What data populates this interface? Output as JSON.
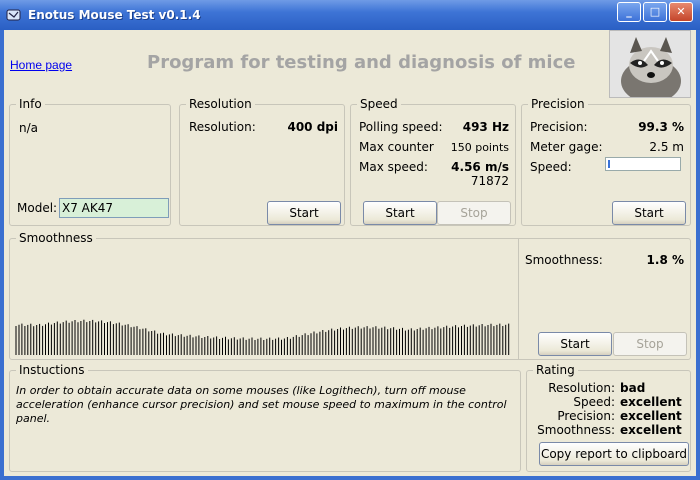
{
  "window": {
    "title": "Enotus Mouse Test v0.1.4",
    "minimize": "_",
    "maximize": "□",
    "close": "✕"
  },
  "header": {
    "home_link": "Home page",
    "headline": "Program for testing and diagnosis of mice"
  },
  "info": {
    "legend": "Info",
    "value": "n/a",
    "model_label": "Model:",
    "model_value": "X7 AK47"
  },
  "resolution": {
    "legend": "Resolution",
    "label": "Resolution:",
    "value": "400 dpi",
    "start": "Start"
  },
  "speed": {
    "legend": "Speed",
    "polling_label": "Polling speed:",
    "polling_value": "493 Hz",
    "max_counter_label": "Max counter",
    "max_counter_value": "150 points",
    "max_speed_label": "Max  speed:",
    "max_speed_value": "4.56 m/s",
    "extra_value": "71872",
    "start": "Start",
    "stop": "Stop"
  },
  "precision": {
    "legend": "Precision",
    "precision_label": "Precision:",
    "precision_value": "99.3 %",
    "gage_label": "Meter gage:",
    "gage_value": "2.5 m",
    "speed_label": "Speed:",
    "speed_fraction": 0.03,
    "start": "Start"
  },
  "smoothness": {
    "legend": "Smoothness",
    "label": "Smoothness:",
    "value": "1.8 %",
    "start": "Start",
    "stop": "Stop",
    "accent": "#000000"
  },
  "instructions": {
    "legend": "Instuctions",
    "text": "In order to obtain accurate data on some mouses (like Logithech), turn off mouse acceleration (enhance cursor precision) and set mouse speed to maximum in the control panel."
  },
  "rating": {
    "legend": "Rating",
    "rows": [
      {
        "label": "Resolution:",
        "value": "bad"
      },
      {
        "label": "Speed:",
        "value": "excellent"
      },
      {
        "label": "Precision:",
        "value": "excellent"
      },
      {
        "label": "Smoothness:",
        "value": "excellent"
      }
    ],
    "copy_button": "Copy report to clipboard"
  },
  "colors": {
    "titlebar": "#2a5fc4",
    "client_bg": "#ece9d8",
    "link": "#0000ee",
    "headline": "#a4a4a4",
    "model_bg": "#d8f0d8",
    "progress": "#3a72d8"
  }
}
